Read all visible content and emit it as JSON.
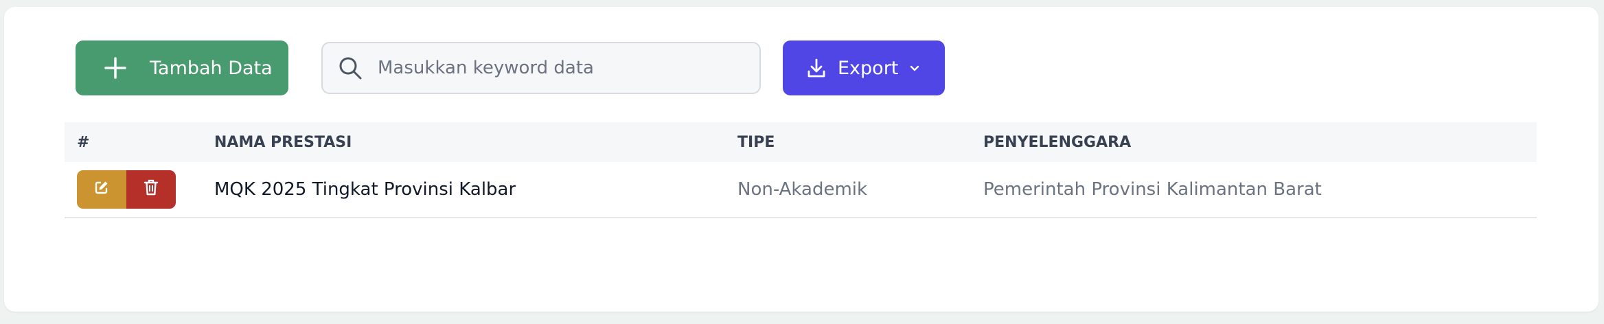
{
  "toolbar": {
    "add_label": "Tambah Data",
    "search_placeholder": "Masukkan keyword data",
    "search_value": "",
    "export_label": "Export"
  },
  "colors": {
    "add_button": "#479b6f",
    "export_button": "#4f46e5",
    "edit_action": "#cc9430",
    "delete_action": "#b6302a"
  },
  "table": {
    "headers": [
      "#",
      "NAMA PRESTASI",
      "TIPE",
      "PENYELENGGARA"
    ],
    "rows": [
      {
        "name": "MQK 2025 Tingkat Provinsi Kalbar",
        "type": "Non-Akademik",
        "organizer": "Pemerintah Provinsi Kalimantan Barat"
      }
    ]
  },
  "icons": {
    "add": "plus-icon",
    "search": "search-icon",
    "export": "download-icon",
    "dropdown": "chevron-down-icon",
    "edit": "edit-icon",
    "delete": "trash-icon"
  }
}
